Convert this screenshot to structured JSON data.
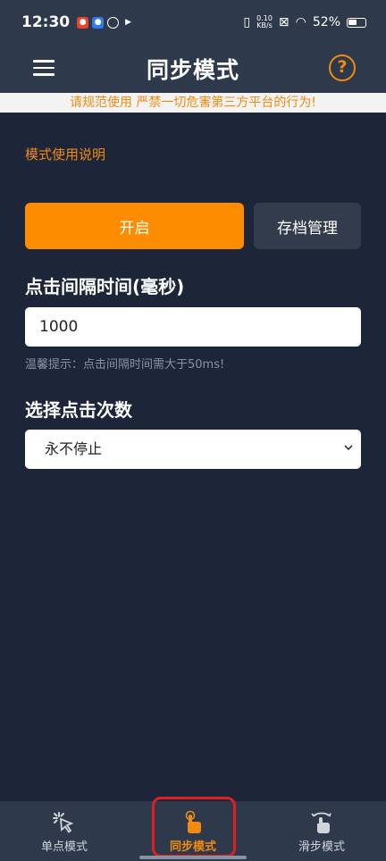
{
  "status": {
    "time": "12:30",
    "net_speed_value": "0.10",
    "net_speed_unit": "KB/s",
    "battery": "52%"
  },
  "header": {
    "title": "同步模式"
  },
  "warning": "请规范使用 严禁一切危害第三方平台的行为!",
  "instructions_link": "模式使用说明",
  "buttons": {
    "start": "开启",
    "save_manage": "存档管理"
  },
  "interval": {
    "label": "点击间隔时间(毫秒)",
    "value": "1000",
    "hint": "温馨提示：点击间隔时间需大于50ms!"
  },
  "count": {
    "label": "选择点击次数",
    "selected": "永不停止"
  },
  "nav": [
    {
      "label": "单点模式",
      "icon": "tap-icon",
      "active": false
    },
    {
      "label": "同步模式",
      "icon": "hand-pointer-icon",
      "active": true
    },
    {
      "label": "滑步模式",
      "icon": "swipe-icon",
      "active": false
    }
  ],
  "colors": {
    "accent": "#fe8c00",
    "background": "#1c2638",
    "bar": "#2e3a4c",
    "highlight": "#e02020"
  }
}
